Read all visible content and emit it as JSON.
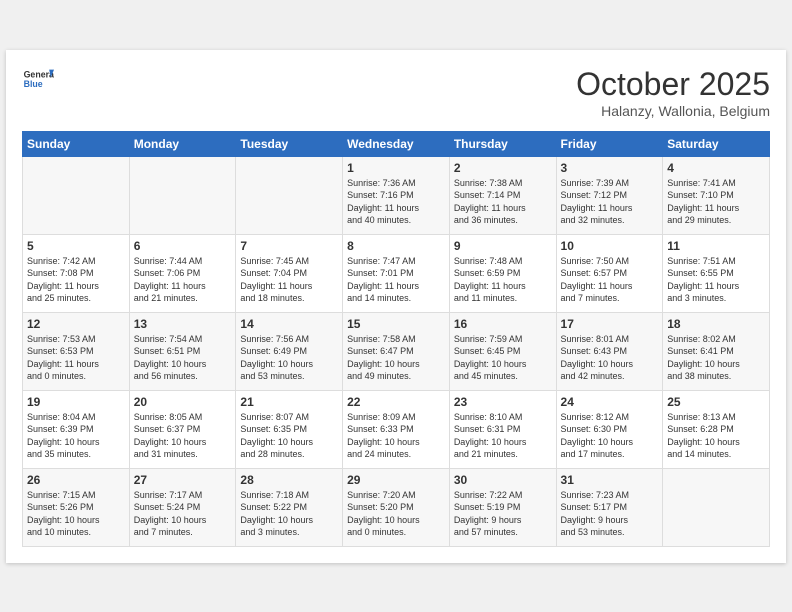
{
  "header": {
    "logo_line1": "General",
    "logo_line2": "Blue",
    "month": "October 2025",
    "location": "Halanzy, Wallonia, Belgium"
  },
  "days_of_week": [
    "Sunday",
    "Monday",
    "Tuesday",
    "Wednesday",
    "Thursday",
    "Friday",
    "Saturday"
  ],
  "weeks": [
    [
      {
        "day": "",
        "info": ""
      },
      {
        "day": "",
        "info": ""
      },
      {
        "day": "",
        "info": ""
      },
      {
        "day": "1",
        "info": "Sunrise: 7:36 AM\nSunset: 7:16 PM\nDaylight: 11 hours\nand 40 minutes."
      },
      {
        "day": "2",
        "info": "Sunrise: 7:38 AM\nSunset: 7:14 PM\nDaylight: 11 hours\nand 36 minutes."
      },
      {
        "day": "3",
        "info": "Sunrise: 7:39 AM\nSunset: 7:12 PM\nDaylight: 11 hours\nand 32 minutes."
      },
      {
        "day": "4",
        "info": "Sunrise: 7:41 AM\nSunset: 7:10 PM\nDaylight: 11 hours\nand 29 minutes."
      }
    ],
    [
      {
        "day": "5",
        "info": "Sunrise: 7:42 AM\nSunset: 7:08 PM\nDaylight: 11 hours\nand 25 minutes."
      },
      {
        "day": "6",
        "info": "Sunrise: 7:44 AM\nSunset: 7:06 PM\nDaylight: 11 hours\nand 21 minutes."
      },
      {
        "day": "7",
        "info": "Sunrise: 7:45 AM\nSunset: 7:04 PM\nDaylight: 11 hours\nand 18 minutes."
      },
      {
        "day": "8",
        "info": "Sunrise: 7:47 AM\nSunset: 7:01 PM\nDaylight: 11 hours\nand 14 minutes."
      },
      {
        "day": "9",
        "info": "Sunrise: 7:48 AM\nSunset: 6:59 PM\nDaylight: 11 hours\nand 11 minutes."
      },
      {
        "day": "10",
        "info": "Sunrise: 7:50 AM\nSunset: 6:57 PM\nDaylight: 11 hours\nand 7 minutes."
      },
      {
        "day": "11",
        "info": "Sunrise: 7:51 AM\nSunset: 6:55 PM\nDaylight: 11 hours\nand 3 minutes."
      }
    ],
    [
      {
        "day": "12",
        "info": "Sunrise: 7:53 AM\nSunset: 6:53 PM\nDaylight: 11 hours\nand 0 minutes."
      },
      {
        "day": "13",
        "info": "Sunrise: 7:54 AM\nSunset: 6:51 PM\nDaylight: 10 hours\nand 56 minutes."
      },
      {
        "day": "14",
        "info": "Sunrise: 7:56 AM\nSunset: 6:49 PM\nDaylight: 10 hours\nand 53 minutes."
      },
      {
        "day": "15",
        "info": "Sunrise: 7:58 AM\nSunset: 6:47 PM\nDaylight: 10 hours\nand 49 minutes."
      },
      {
        "day": "16",
        "info": "Sunrise: 7:59 AM\nSunset: 6:45 PM\nDaylight: 10 hours\nand 45 minutes."
      },
      {
        "day": "17",
        "info": "Sunrise: 8:01 AM\nSunset: 6:43 PM\nDaylight: 10 hours\nand 42 minutes."
      },
      {
        "day": "18",
        "info": "Sunrise: 8:02 AM\nSunset: 6:41 PM\nDaylight: 10 hours\nand 38 minutes."
      }
    ],
    [
      {
        "day": "19",
        "info": "Sunrise: 8:04 AM\nSunset: 6:39 PM\nDaylight: 10 hours\nand 35 minutes."
      },
      {
        "day": "20",
        "info": "Sunrise: 8:05 AM\nSunset: 6:37 PM\nDaylight: 10 hours\nand 31 minutes."
      },
      {
        "day": "21",
        "info": "Sunrise: 8:07 AM\nSunset: 6:35 PM\nDaylight: 10 hours\nand 28 minutes."
      },
      {
        "day": "22",
        "info": "Sunrise: 8:09 AM\nSunset: 6:33 PM\nDaylight: 10 hours\nand 24 minutes."
      },
      {
        "day": "23",
        "info": "Sunrise: 8:10 AM\nSunset: 6:31 PM\nDaylight: 10 hours\nand 21 minutes."
      },
      {
        "day": "24",
        "info": "Sunrise: 8:12 AM\nSunset: 6:30 PM\nDaylight: 10 hours\nand 17 minutes."
      },
      {
        "day": "25",
        "info": "Sunrise: 8:13 AM\nSunset: 6:28 PM\nDaylight: 10 hours\nand 14 minutes."
      }
    ],
    [
      {
        "day": "26",
        "info": "Sunrise: 7:15 AM\nSunset: 5:26 PM\nDaylight: 10 hours\nand 10 minutes."
      },
      {
        "day": "27",
        "info": "Sunrise: 7:17 AM\nSunset: 5:24 PM\nDaylight: 10 hours\nand 7 minutes."
      },
      {
        "day": "28",
        "info": "Sunrise: 7:18 AM\nSunset: 5:22 PM\nDaylight: 10 hours\nand 3 minutes."
      },
      {
        "day": "29",
        "info": "Sunrise: 7:20 AM\nSunset: 5:20 PM\nDaylight: 10 hours\nand 0 minutes."
      },
      {
        "day": "30",
        "info": "Sunrise: 7:22 AM\nSunset: 5:19 PM\nDaylight: 9 hours\nand 57 minutes."
      },
      {
        "day": "31",
        "info": "Sunrise: 7:23 AM\nSunset: 5:17 PM\nDaylight: 9 hours\nand 53 minutes."
      },
      {
        "day": "",
        "info": ""
      }
    ]
  ]
}
